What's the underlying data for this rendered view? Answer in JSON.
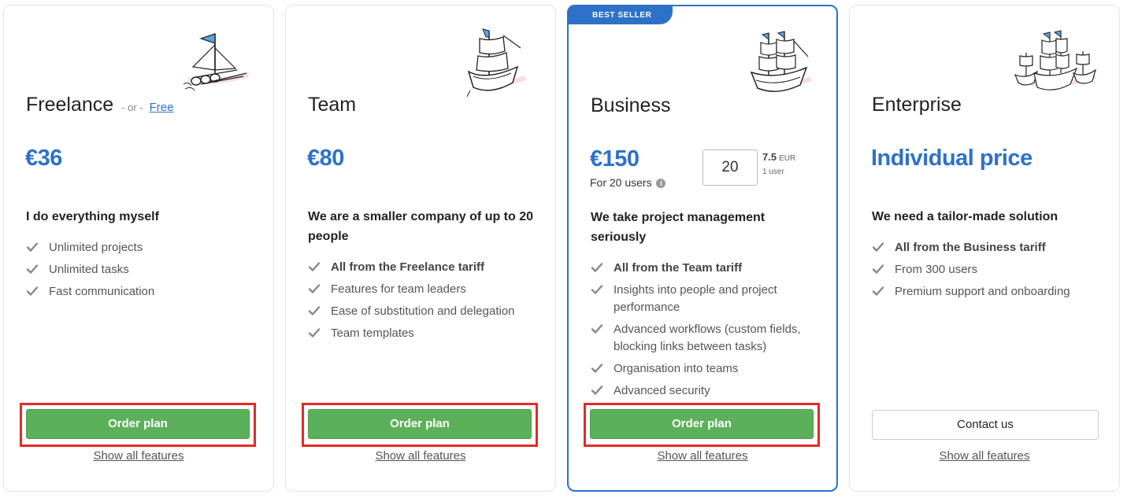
{
  "plans": [
    {
      "name": "Freelance",
      "or_text": "- or -",
      "free_link": "Free",
      "price": "€36",
      "description": "I do everything myself",
      "features": [
        "Unlimited projects",
        "Unlimited tasks",
        "Fast communication"
      ],
      "button": "Order plan",
      "show_all": "Show all features"
    },
    {
      "name": "Team",
      "price": "€80",
      "description": "We are a smaller company of up to 20 people",
      "features": [
        "All from the Freelance tariff",
        "Features for team leaders",
        "Ease of substitution and delegation",
        "Team templates"
      ],
      "button": "Order plan",
      "show_all": "Show all features"
    },
    {
      "name": "Business",
      "badge": "BEST SELLER",
      "price": "€150",
      "users_note": "For 20 users",
      "users_value": "20",
      "unit_price": "7.5",
      "unit_currency": "EUR",
      "unit_label": "1 user",
      "description": "We take project management seriously",
      "features": [
        "All from the Team tariff",
        "Insights into people and project performance",
        "Advanced workflows (custom fields, blocking links between tasks)",
        "Organisation into teams",
        "Advanced security"
      ],
      "button": "Order plan",
      "show_all": "Show all features"
    },
    {
      "name": "Enterprise",
      "price": "Individual price",
      "description": "We need a tailor-made solution",
      "features": [
        "All from the Business tariff",
        "From 300 users",
        "Premium support and onboarding"
      ],
      "button": "Contact us",
      "show_all": "Show all features"
    }
  ],
  "colors": {
    "accent": "#2d72c8",
    "button_green": "#5cb05a",
    "highlight_red": "#e22b24"
  }
}
